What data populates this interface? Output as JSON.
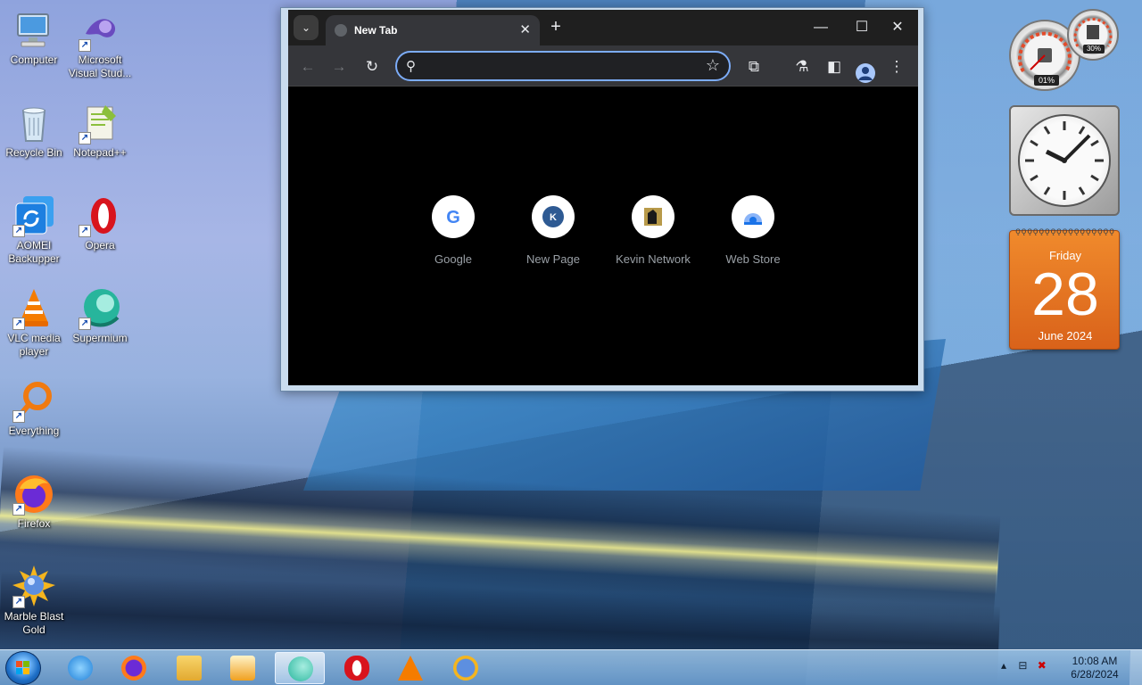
{
  "desktop": {
    "icons": [
      {
        "label": "Computer",
        "icon": "computer-icon"
      },
      {
        "label": "Microsoft Visual Stud...",
        "icon": "visual-studio-icon"
      },
      {
        "label": "Recycle Bin",
        "icon": "recycle-bin-icon"
      },
      {
        "label": "Notepad++",
        "icon": "notepad-plus-plus-icon"
      },
      {
        "label": "AOMEI Backupper",
        "icon": "aomei-backupper-icon"
      },
      {
        "label": "Opera",
        "icon": "opera-icon"
      },
      {
        "label": "VLC media player",
        "icon": "vlc-icon"
      },
      {
        "label": "Supermium",
        "icon": "supermium-icon"
      },
      {
        "label": "Everything",
        "icon": "everything-icon"
      },
      {
        "label": "Firefox",
        "icon": "firefox-icon"
      },
      {
        "label": "Marble Blast Gold",
        "icon": "marble-blast-icon"
      }
    ]
  },
  "browser": {
    "tab_title": "New Tab",
    "omnibox_placeholder": "",
    "shortcuts": [
      {
        "label": "Google",
        "icon": "google-icon"
      },
      {
        "label": "New Page",
        "icon": "k-letter-icon",
        "letter": "K"
      },
      {
        "label": "Kevin Network",
        "icon": "kevin-network-icon"
      },
      {
        "label": "Web Store",
        "icon": "web-store-icon"
      }
    ],
    "colors": {
      "frame": "#1f1f1f",
      "toolbar": "#35363a",
      "content": "#000000",
      "focus_ring": "#7cacf8"
    }
  },
  "gadgets": {
    "cpu_meter": {
      "cpu": "01%",
      "memory": "30%"
    },
    "calendar": {
      "weekday": "Friday",
      "day": "28",
      "month_year": "June 2024",
      "color": "#e8721f"
    }
  },
  "taskbar": {
    "pinned": [
      "internet-explorer-icon",
      "firefox-icon",
      "file-explorer-icon",
      "media-player-icon",
      "supermium-icon",
      "opera-icon",
      "vlc-icon",
      "marble-blast-icon"
    ],
    "active_app": "supermium-icon",
    "time": "10:08 AM",
    "date": "6/28/2024"
  }
}
